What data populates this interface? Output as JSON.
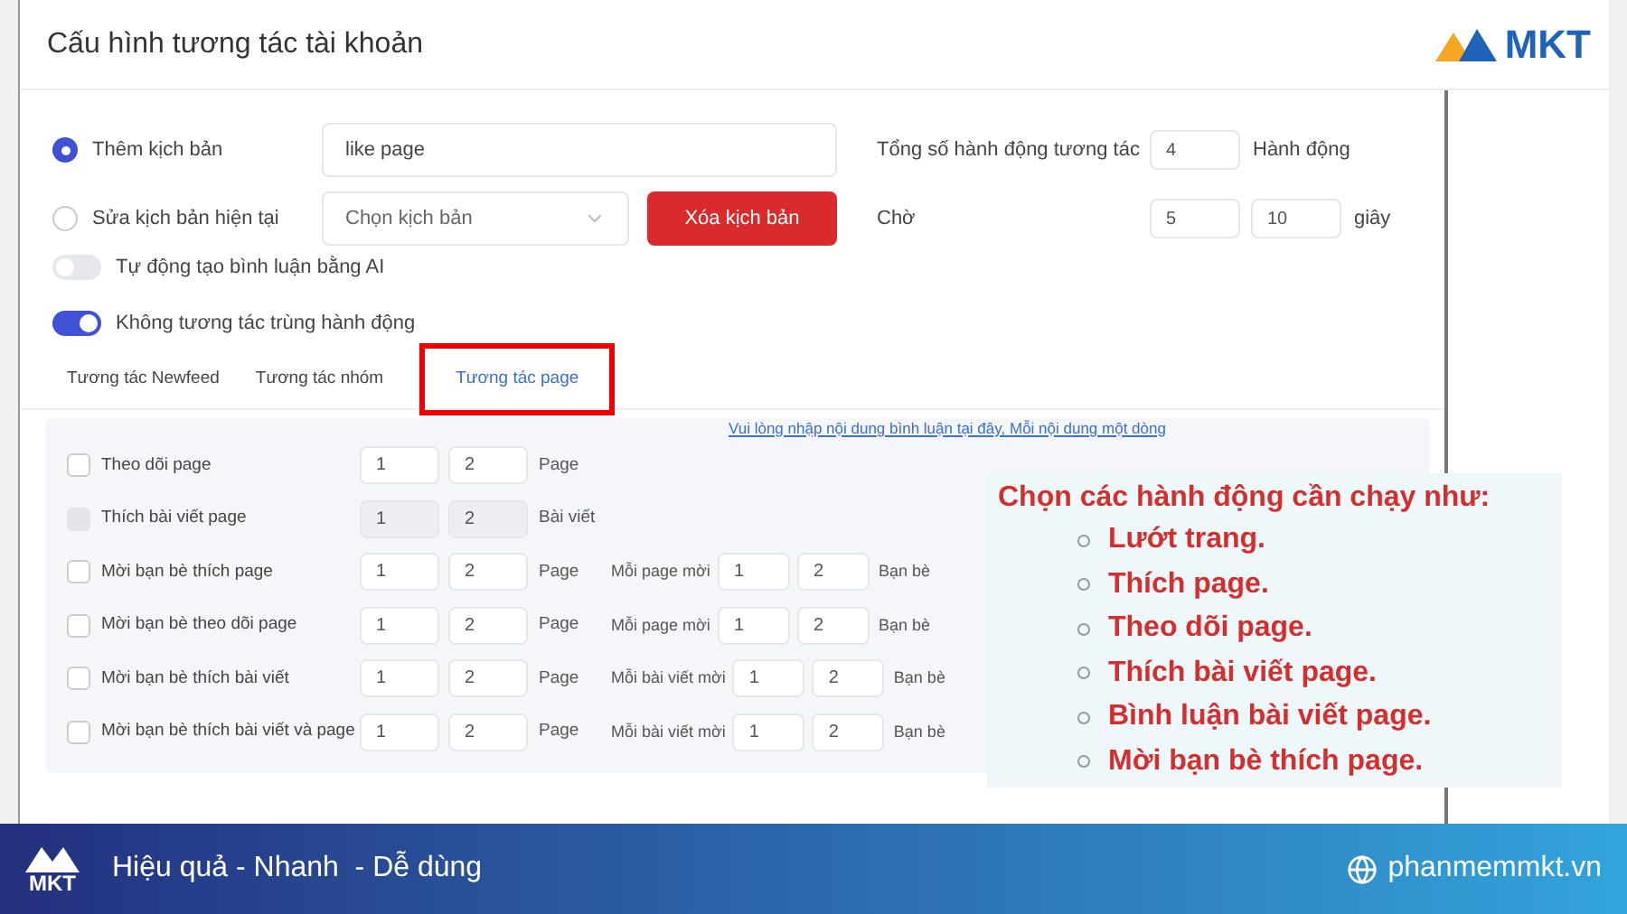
{
  "window": {
    "title": "Cấu hình tương tác tài khoản"
  },
  "brand_logo": {
    "text": "MKT"
  },
  "form": {
    "modes": [
      {
        "label": "Thêm kịch bản",
        "selected": true
      },
      {
        "label": "Sửa kịch bản hiện tại",
        "selected": false
      }
    ],
    "name_value": "like page",
    "script_select_placeholder": "Chọn kịch bản",
    "delete_button": "Xóa kịch bản",
    "total_label": "Tổng số hành động tương tác",
    "total_value": "4",
    "total_unit": "Hành động",
    "wait_label": "Chờ",
    "wait_min": "5",
    "wait_max": "10",
    "wait_unit": "giây"
  },
  "toggles": [
    {
      "label": "Tự động tạo bình luận bằng AI",
      "on": false
    },
    {
      "label": "Không tương tác trùng hành động",
      "on": true
    }
  ],
  "tabs": [
    {
      "label": "Tương tác Newfeed",
      "selected": false
    },
    {
      "label": "Tương tác nhóm",
      "selected": false
    },
    {
      "label": "Tương tác page",
      "selected": true
    }
  ],
  "actions": {
    "hint_link": "Vui lòng nhập nội dung bình luận tại đây, Mỗi nội dung một dòng",
    "rows": [
      {
        "label": "Theo dõi page",
        "checked": false,
        "disabled": false,
        "min": "1",
        "max": "2",
        "unit": "Page"
      },
      {
        "label": "Thích bài viết page",
        "checked": false,
        "disabled": true,
        "min": "1",
        "max": "2",
        "unit": "Bài viết"
      },
      {
        "label": "Mời bạn bè thích page",
        "checked": false,
        "disabled": false,
        "min": "1",
        "max": "2",
        "unit": "Page",
        "per_label": "Mỗi page mời",
        "per_min": "1",
        "per_max": "2",
        "per_unit": "Bạn bè"
      },
      {
        "label": "Mời bạn bè theo dõi page",
        "checked": false,
        "disabled": false,
        "min": "1",
        "max": "2",
        "unit": "Page",
        "per_label": "Mỗi page mời",
        "per_min": "1",
        "per_max": "2",
        "per_unit": "Bạn bè"
      },
      {
        "label": "Mời bạn bè thích bài viết",
        "checked": false,
        "disabled": false,
        "min": "1",
        "max": "2",
        "unit": "Page",
        "per_label": "Mỗi bài viết mời",
        "per_min": "1",
        "per_max": "2",
        "per_unit": "Bạn bè"
      },
      {
        "label": "Mời bạn bè thích bài viết và page",
        "checked": false,
        "disabled": false,
        "min": "1",
        "max": "2",
        "unit": "Page",
        "per_label": "Mỗi bài viết mời",
        "per_min": "1",
        "per_max": "2",
        "per_unit": "Bạn bè"
      }
    ]
  },
  "annotation": {
    "title": "Chọn các hành động cần chạy như:",
    "items": [
      "Lướt trang.",
      "Thích page.",
      "Theo dõi page.",
      "Thích bài viết page.",
      "Bình luận bài viết page.",
      "Mời bạn bè thích page."
    ]
  },
  "footer": {
    "logo_text": "MKT",
    "slogan": "Hiệu quả - Nhanh  - Dễ dùng",
    "website": "phanmemmkt.vn"
  }
}
